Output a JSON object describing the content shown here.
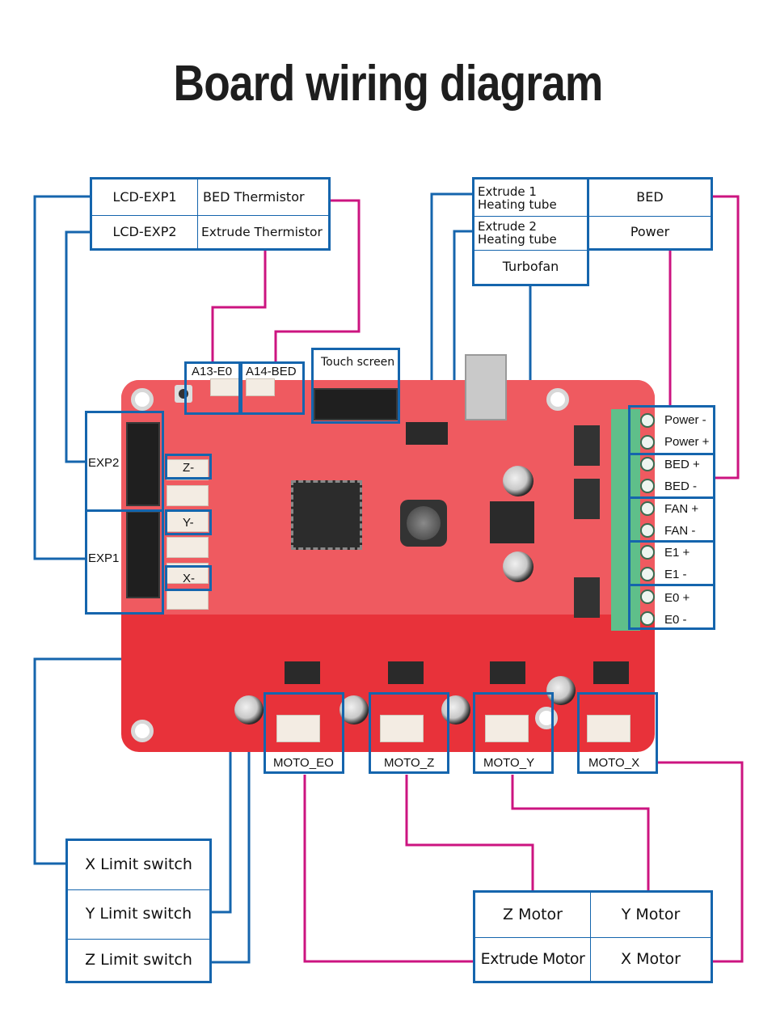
{
  "title": "Board wiring diagram",
  "colors": {
    "box_border": "#1565ad",
    "wire_blue": "#1565ad",
    "wire_magenta": "#cc1480",
    "board_red": "#e8323a",
    "terminal_green": "#5fbf8a"
  },
  "top_left_table": {
    "rows": [
      {
        "left": "LCD-EXP1",
        "right": "BED Thermistor"
      },
      {
        "left": "LCD-EXP2",
        "right": "Extrude Thermistor"
      }
    ]
  },
  "top_right_table": {
    "left_cells": [
      {
        "line1": "Extrude 1",
        "line2": "Heating tube"
      },
      {
        "line1": "Extrude 2",
        "line2": "Heating tube"
      },
      {
        "line1": "Turbofan",
        "line2": ""
      }
    ],
    "right_cells": [
      "BED",
      "Power"
    ]
  },
  "board_labels": {
    "a13": "A13-E0",
    "a14": "A14-BED",
    "touch_screen": "Touch screen",
    "exp2": "EXP2",
    "exp1": "EXP1",
    "z_minus": "Z-",
    "y_minus": "Y-",
    "x_minus": "X-"
  },
  "terminals": [
    {
      "label": "Power -"
    },
    {
      "label": "Power +"
    },
    {
      "label": "BED +"
    },
    {
      "label": "BED -"
    },
    {
      "label": "FAN +"
    },
    {
      "label": "FAN -"
    },
    {
      "label": "E1 +"
    },
    {
      "label": "E1 -"
    },
    {
      "label": "E0 +"
    },
    {
      "label": "E0 -"
    }
  ],
  "motor_ports": [
    "MOTO_EO",
    "MOTO_Z",
    "MOTO_Y",
    "MOTO_X"
  ],
  "limit_switches": [
    "X Limit switch",
    "Y Limit switch",
    "Z Limit switch"
  ],
  "motor_table": {
    "rows": [
      {
        "left": "Z Motor",
        "right": "Y Motor"
      },
      {
        "left": "Extrude Motor",
        "right": "X Motor"
      }
    ]
  }
}
